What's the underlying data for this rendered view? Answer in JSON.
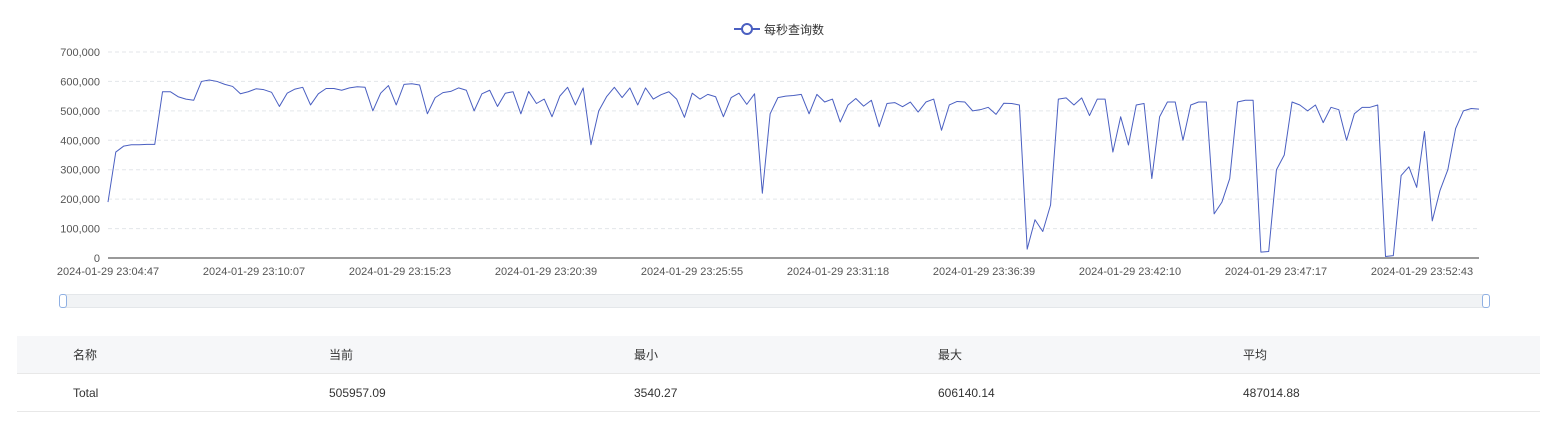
{
  "colors": {
    "series": "#4a5fc1",
    "grid": "#e3e6ea",
    "axis": "#333333"
  },
  "chart_data": {
    "type": "line",
    "legend_position": "top-center",
    "grid": true,
    "series": [
      {
        "name": "每秒查询数",
        "values": [
          190000,
          360000,
          380000,
          385000,
          385000,
          386000,
          386000,
          565000,
          565000,
          548000,
          540000,
          536000,
          600000,
          605000,
          600000,
          590000,
          583000,
          558000,
          565000,
          575000,
          572000,
          563000,
          515000,
          560000,
          574000,
          580000,
          520000,
          558000,
          576000,
          576000,
          570000,
          578000,
          582000,
          580000,
          500000,
          560000,
          586000,
          520000,
          590000,
          592000,
          588000,
          490000,
          545000,
          562000,
          566000,
          578000,
          570000,
          500000,
          558000,
          570000,
          515000,
          560000,
          565000,
          490000,
          566000,
          525000,
          540000,
          480000,
          550000,
          580000,
          520000,
          578000,
          385000,
          500000,
          548000,
          580000,
          545000,
          578000,
          520000,
          578000,
          540000,
          555000,
          565000,
          540000,
          478000,
          560000,
          540000,
          556000,
          548000,
          480000,
          545000,
          560000,
          522000,
          558000,
          220000,
          490000,
          545000,
          550000,
          552000,
          556000,
          490000,
          556000,
          530000,
          540000,
          462000,
          520000,
          542000,
          516000,
          536000,
          446000,
          525000,
          528000,
          514000,
          530000,
          496000,
          530000,
          540000,
          434000,
          520000,
          532000,
          530000,
          500000,
          504000,
          512000,
          488000,
          526000,
          525000,
          520000,
          30000,
          130000,
          90000,
          180000,
          540000,
          544000,
          520000,
          544000,
          484000,
          540000,
          540000,
          360000,
          480000,
          384000,
          520000,
          525000,
          270000,
          480000,
          530000,
          530000,
          400000,
          520000,
          530000,
          530000,
          150000,
          190000,
          270000,
          530000,
          536000,
          536000,
          20000,
          22000,
          300000,
          350000,
          530000,
          520000,
          500000,
          520000,
          460000,
          512000,
          504000,
          400000,
          490000,
          512000,
          512000,
          520000,
          5000,
          8000,
          280000,
          310000,
          240000,
          430000,
          126000,
          230000,
          300000,
          440000,
          500000,
          508000,
          506000
        ]
      }
    ],
    "x_labels": [
      "2024-01-29 23:04:47",
      "2024-01-29 23:10:07",
      "2024-01-29 23:15:23",
      "2024-01-29 23:20:39",
      "2024-01-29 23:25:55",
      "2024-01-29 23:31:18",
      "2024-01-29 23:36:39",
      "2024-01-29 23:42:10",
      "2024-01-29 23:47:17",
      "2024-01-29 23:52:43"
    ],
    "y_ticks": [
      0,
      100000,
      200000,
      300000,
      400000,
      500000,
      600000,
      700000
    ],
    "y_tick_labels": [
      "0",
      "100,000",
      "200,000",
      "300,000",
      "400,000",
      "500,000",
      "600,000",
      "700,000"
    ],
    "ylim": [
      0,
      700000
    ]
  },
  "table": {
    "headers": [
      "名称",
      "当前",
      "最小",
      "最大",
      "平均"
    ],
    "rows": [
      [
        "Total",
        "505957.09",
        "3540.27",
        "606140.14",
        "487014.88"
      ]
    ]
  }
}
